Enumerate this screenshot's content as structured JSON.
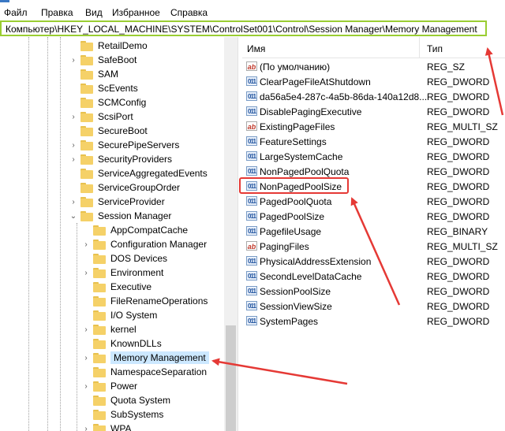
{
  "menu": [
    "Файл",
    "Правка",
    "Вид",
    "Избранное",
    "Справка"
  ],
  "address": "Компьютер\\HKEY_LOCAL_MACHINE\\SYSTEM\\ControlSet001\\Control\\Session Manager\\Memory Management",
  "tree": {
    "items": [
      {
        "label": "RetailDemo",
        "level": 1,
        "expand": ""
      },
      {
        "label": "SafeBoot",
        "level": 1,
        "expand": ">"
      },
      {
        "label": "SAM",
        "level": 1,
        "expand": ""
      },
      {
        "label": "ScEvents",
        "level": 1,
        "expand": ""
      },
      {
        "label": "SCMConfig",
        "level": 1,
        "expand": ""
      },
      {
        "label": "ScsiPort",
        "level": 1,
        "expand": ">"
      },
      {
        "label": "SecureBoot",
        "level": 1,
        "expand": ""
      },
      {
        "label": "SecurePipeServers",
        "level": 1,
        "expand": ">"
      },
      {
        "label": "SecurityProviders",
        "level": 1,
        "expand": ">"
      },
      {
        "label": "ServiceAggregatedEvents",
        "level": 1,
        "expand": ""
      },
      {
        "label": "ServiceGroupOrder",
        "level": 1,
        "expand": ""
      },
      {
        "label": "ServiceProvider",
        "level": 1,
        "expand": ">"
      },
      {
        "label": "Session Manager",
        "level": 1,
        "expand": "v"
      },
      {
        "label": "AppCompatCache",
        "level": 2,
        "expand": ""
      },
      {
        "label": "Configuration Manager",
        "level": 2,
        "expand": ">"
      },
      {
        "label": "DOS Devices",
        "level": 2,
        "expand": ""
      },
      {
        "label": "Environment",
        "level": 2,
        "expand": ">"
      },
      {
        "label": "Executive",
        "level": 2,
        "expand": ""
      },
      {
        "label": "FileRenameOperations",
        "level": 2,
        "expand": ""
      },
      {
        "label": "I/O System",
        "level": 2,
        "expand": ""
      },
      {
        "label": "kernel",
        "level": 2,
        "expand": ">"
      },
      {
        "label": "KnownDLLs",
        "level": 2,
        "expand": ""
      },
      {
        "label": "Memory Management",
        "level": 2,
        "expand": ">",
        "selected": true
      },
      {
        "label": "NamespaceSeparation",
        "level": 2,
        "expand": ""
      },
      {
        "label": "Power",
        "level": 2,
        "expand": ">"
      },
      {
        "label": "Quota System",
        "level": 2,
        "expand": ""
      },
      {
        "label": "SubSystems",
        "level": 2,
        "expand": ""
      },
      {
        "label": "WPA",
        "level": 2,
        "expand": ">"
      }
    ]
  },
  "list": {
    "col_name": "Имя",
    "col_type": "Тип",
    "rows": [
      {
        "icon": "string-value-icon",
        "name": "(По умолчанию)",
        "type": "REG_SZ"
      },
      {
        "icon": "binary-value-icon",
        "name": "ClearPageFileAtShutdown",
        "type": "REG_DWORD"
      },
      {
        "icon": "binary-value-icon",
        "name": "da56a5e4-287c-4a5b-86da-140a12d8...",
        "type": "REG_DWORD"
      },
      {
        "icon": "binary-value-icon",
        "name": "DisablePagingExecutive",
        "type": "REG_DWORD"
      },
      {
        "icon": "string-value-icon",
        "name": "ExistingPageFiles",
        "type": "REG_MULTI_SZ"
      },
      {
        "icon": "binary-value-icon",
        "name": "FeatureSettings",
        "type": "REG_DWORD"
      },
      {
        "icon": "binary-value-icon",
        "name": "LargeSystemCache",
        "type": "REG_DWORD"
      },
      {
        "icon": "binary-value-icon",
        "name": "NonPagedPoolQuota",
        "type": "REG_DWORD"
      },
      {
        "icon": "binary-value-icon",
        "name": "NonPagedPoolSize",
        "type": "REG_DWORD"
      },
      {
        "icon": "binary-value-icon",
        "name": "PagedPoolQuota",
        "type": "REG_DWORD"
      },
      {
        "icon": "binary-value-icon",
        "name": "PagedPoolSize",
        "type": "REG_DWORD"
      },
      {
        "icon": "binary-value-icon",
        "name": "PagefileUsage",
        "type": "REG_BINARY"
      },
      {
        "icon": "string-value-icon",
        "name": "PagingFiles",
        "type": "REG_MULTI_SZ"
      },
      {
        "icon": "binary-value-icon",
        "name": "PhysicalAddressExtension",
        "type": "REG_DWORD"
      },
      {
        "icon": "binary-value-icon",
        "name": "SecondLevelDataCache",
        "type": "REG_DWORD"
      },
      {
        "icon": "binary-value-icon",
        "name": "SessionPoolSize",
        "type": "REG_DWORD"
      },
      {
        "icon": "binary-value-icon",
        "name": "SessionViewSize",
        "type": "REG_DWORD"
      },
      {
        "icon": "binary-value-icon",
        "name": "SystemPages",
        "type": "REG_DWORD"
      }
    ]
  },
  "highlight": {
    "value_name": "NonPagedPoolSize",
    "tree_item": "Memory Management"
  },
  "colors": {
    "annotation": "#e53935",
    "address_border": "#9acd32",
    "selection": "#cce8ff"
  }
}
